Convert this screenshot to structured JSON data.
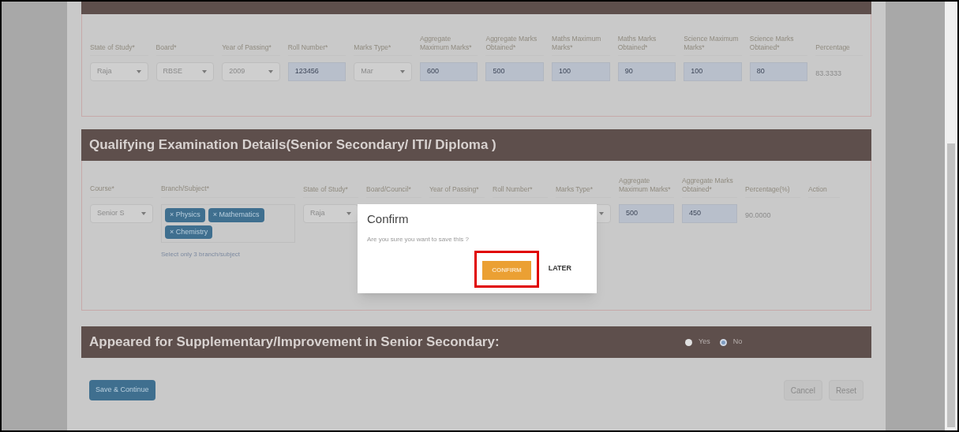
{
  "academic_section": {
    "columns": [
      {
        "label": "State of Study*",
        "value": "Raja",
        "kind": "select"
      },
      {
        "label": "Board*",
        "value": "RBSE",
        "kind": "select"
      },
      {
        "label": "Year of Passing*",
        "value": "2009",
        "kind": "select"
      },
      {
        "label": "Roll Number*",
        "value": "123456",
        "kind": "input"
      },
      {
        "label": "Marks Type*",
        "value": "Mar",
        "kind": "select"
      },
      {
        "label": "Aggregate Maximum Marks*",
        "value": "600",
        "kind": "input"
      },
      {
        "label": "Aggregate Marks Obtained*",
        "value": "500",
        "kind": "input"
      },
      {
        "label": "Maths Maximum Marks*",
        "value": "100",
        "kind": "input"
      },
      {
        "label": "Maths Marks Obtained*",
        "value": "90",
        "kind": "input"
      },
      {
        "label": "Science Maximum Marks*",
        "value": "100",
        "kind": "input"
      },
      {
        "label": "Science Marks Obtained*",
        "value": "80",
        "kind": "input"
      },
      {
        "label": "Percentage",
        "value": "83.3333",
        "kind": "text"
      }
    ]
  },
  "qualifying_section": {
    "title": "Qualifying Examination Details(Senior Secondary/ ITI/ Diploma )",
    "course": {
      "label": "Course*",
      "value": "Senior S"
    },
    "branch": {
      "label": "Branch/Subject*",
      "tags": [
        "× Physics",
        "× Mathematics",
        "× Chemistry"
      ],
      "hint": "Select only 3 branch/subject"
    },
    "columns": [
      {
        "label": "State of Study*",
        "value": "Raja",
        "kind": "select"
      },
      {
        "label": "Board/Council*",
        "kind": "hidden"
      },
      {
        "label": "Year of Passing*",
        "kind": "hidden"
      },
      {
        "label": "Roll Number*",
        "kind": "hidden"
      },
      {
        "label": "Marks Type*",
        "kind": "select"
      },
      {
        "label": "Aggregate Maximum Marks*",
        "value": "500",
        "kind": "input"
      },
      {
        "label": "Aggregate Marks Obtained*",
        "value": "450",
        "kind": "input"
      },
      {
        "label": "Percentage(%)",
        "value": "90.0000",
        "kind": "text"
      },
      {
        "label": "Action",
        "kind": "text"
      }
    ]
  },
  "supplementary_section": {
    "title": "Appeared for Supplementary/Improvement in Senior Secondary:",
    "options": [
      {
        "label": "Yes",
        "selected": false
      },
      {
        "label": "No",
        "selected": true
      }
    ]
  },
  "buttons": {
    "save": "Save & Continue",
    "cancel": "Cancel",
    "reset": "Reset"
  },
  "dialog": {
    "title": "Confirm",
    "message": "Are you sure you want to save this ?",
    "confirm": "CONFIRM",
    "later": "LATER",
    "confirm_highlighted": true
  }
}
